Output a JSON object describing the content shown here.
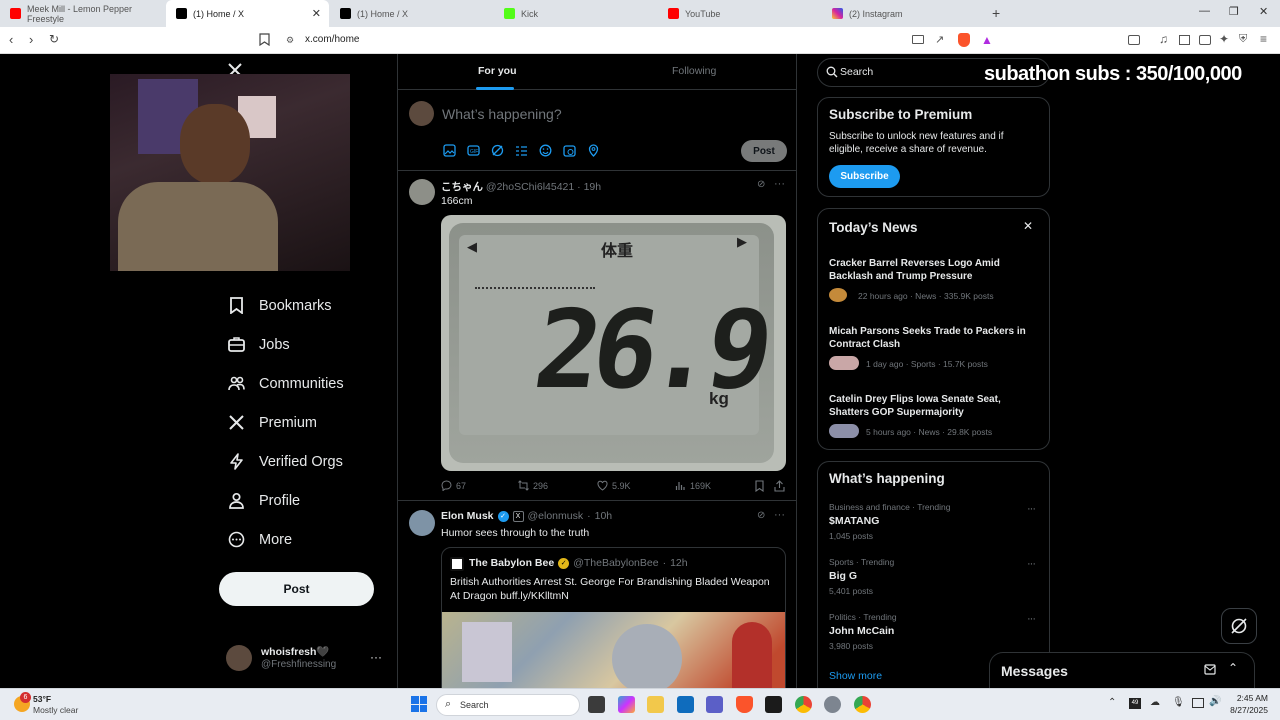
{
  "browser": {
    "tabs": [
      {
        "title": "Meek Mill - Lemon Pepper Freestyle",
        "color": "#ff0000"
      },
      {
        "title": "(1) Home / X",
        "color": "#000000"
      },
      {
        "title": "(1) Home / X",
        "color": "#000000"
      },
      {
        "title": "Kick",
        "color": "#53fc18"
      },
      {
        "title": "YouTube",
        "color": "#ff0000"
      },
      {
        "title": "(2) Instagram",
        "color": "#d6249f"
      }
    ],
    "url": "x.com/home"
  },
  "overlay": {
    "subathon_text": "subathon subs : 350/100,000"
  },
  "nav": {
    "items": [
      "Bookmarks",
      "Jobs",
      "Communities",
      "Premium",
      "Verified Orgs",
      "Profile",
      "More"
    ],
    "post_label": "Post",
    "account_name": "whoisfresh🖤",
    "account_handle": "@Freshfinessing"
  },
  "feed": {
    "tabs": [
      "For you",
      "Following"
    ],
    "composer_placeholder": "What’s happening?",
    "composer_post": "Post",
    "post1": {
      "name": "こちゃん",
      "handle": "@2hoSChi6l45421",
      "time": "19h",
      "text": "166cm",
      "scale_label": "体重",
      "scale_reading": "26.9",
      "scale_unit": "kg",
      "replies": "67",
      "reposts": "296",
      "likes": "5.9K",
      "views": "169K"
    },
    "post2": {
      "name": "Elon Musk",
      "handle": "@elonmusk",
      "time": "10h",
      "text": "Humor sees through to the truth",
      "quote_name": "The Babylon Bee",
      "quote_handle": "@TheBabylonBee",
      "quote_time": "12h",
      "quote_text": "British Authorities Arrest St. George For Brandishing Bladed Weapon At Dragon buff.ly/KKlltmN"
    }
  },
  "sidebar": {
    "search_placeholder": "Search",
    "premium": {
      "title": "Subscribe to Premium",
      "body": "Subscribe to unlock new features and if eligible, receive a share of revenue.",
      "button": "Subscribe"
    },
    "news": {
      "title": "Today’s News",
      "items": [
        {
          "title": "Cracker Barrel Reverses Logo Amid Backlash and Trump Pressure",
          "meta": "22 hours ago · News · 335.9K posts"
        },
        {
          "title": "Micah Parsons Seeks Trade to Packers in Contract Clash",
          "meta": "1 day ago · Sports · 15.7K posts"
        },
        {
          "title": "Catelin Drey Flips Iowa Senate Seat, Shatters GOP Supermajority",
          "meta": "5 hours ago · News · 29.8K posts"
        }
      ]
    },
    "happening": {
      "title": "What’s happening",
      "items": [
        {
          "category": "Business and finance · Trending",
          "name": "$MATANG",
          "count": "1,045 posts"
        },
        {
          "category": "Sports · Trending",
          "name": "Big G",
          "count": "5,401 posts"
        },
        {
          "category": "Politics · Trending",
          "name": "John McCain",
          "count": "3,980 posts"
        }
      ],
      "show_more": "Show more"
    },
    "messages": "Messages"
  },
  "taskbar": {
    "weather_badge": "6",
    "temp": "53°F",
    "weather": "Mostly clear",
    "search": "Search",
    "time": "2:45 AM",
    "date": "8/27/2025"
  },
  "colors": {
    "accent": "#1d9bf0",
    "background": "#000000",
    "border": "#2f3336",
    "muted": "#71767b"
  }
}
